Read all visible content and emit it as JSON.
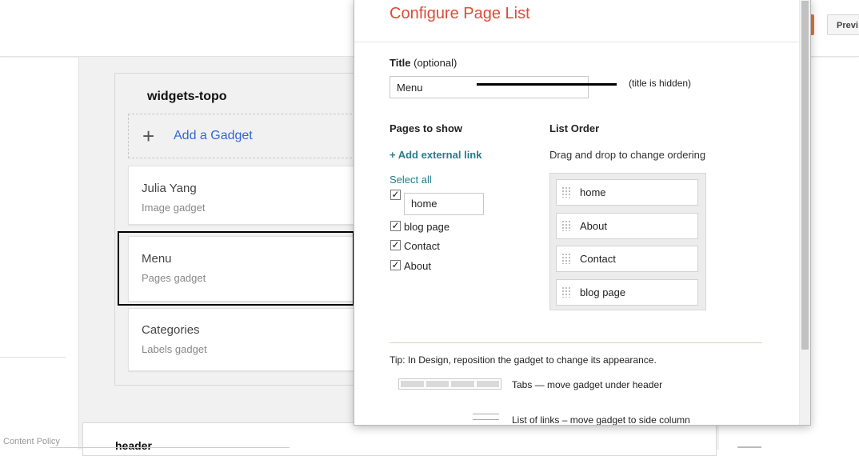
{
  "topbar": {
    "preview_label": "Previ"
  },
  "left": {
    "content_policy": "Content Policy"
  },
  "section": {
    "title": "widgets-topo",
    "add_gadget": "Add a Gadget",
    "gadgets": [
      {
        "name": "Julia Yang",
        "type": "Image gadget"
      },
      {
        "name": "Menu",
        "type": "Pages gadget"
      },
      {
        "name": "Categories",
        "type": "Labels gadget"
      }
    ]
  },
  "header_section": {
    "title": "header"
  },
  "dialog": {
    "title": "Configure Page List",
    "title_label": "Title",
    "title_optional": "(optional)",
    "title_value": "Menu",
    "title_note": "(title is hidden)",
    "pages_heading": "Pages to show",
    "add_external": "+ Add external link",
    "select_all": "Select all",
    "pages": [
      {
        "label": "home",
        "checked": true,
        "editable": true
      },
      {
        "label": "blog page",
        "checked": true
      },
      {
        "label": "Contact",
        "checked": true
      },
      {
        "label": "About",
        "checked": true
      }
    ],
    "order_heading": "List Order",
    "order_note": "Drag and drop to change ordering",
    "order_items": [
      "home",
      "About",
      "Contact",
      "blog page"
    ],
    "tip": "Tip: In Design, reposition the gadget to change its appearance.",
    "tabs_hint": "Tabs — move gadget under header",
    "list_hint": "List of links – move gadget to side column"
  },
  "colors": {
    "dialog_title": "#dd4b39",
    "link": "#2a7b8c",
    "add_gadget": "#3367d6",
    "accent_button": "#e8703a"
  }
}
